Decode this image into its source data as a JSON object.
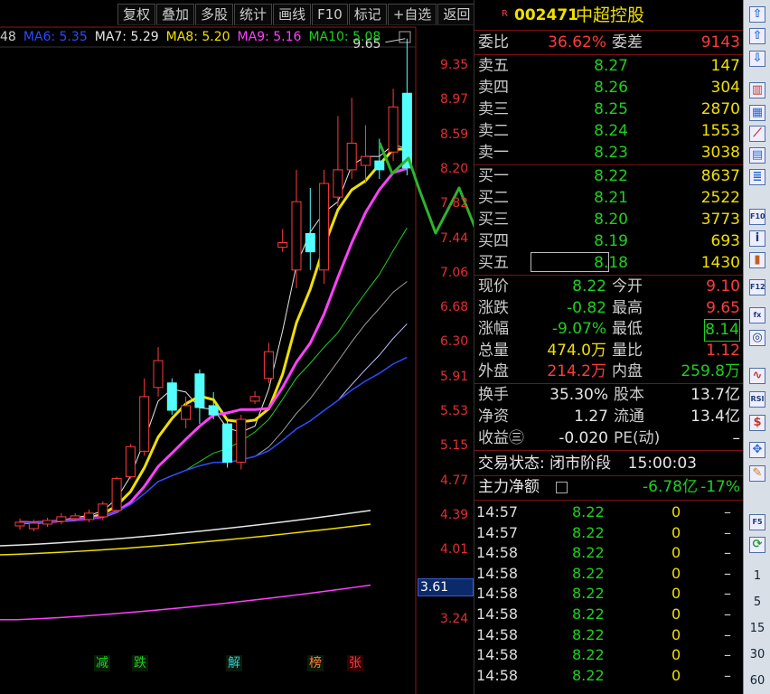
{
  "toolbar": [
    "复权",
    "叠加",
    "多股",
    "统计",
    "画线",
    "F10",
    "标记",
    "+自选",
    "返回"
  ],
  "ma_legend": [
    {
      "label": "48",
      "color": "#cccccc"
    },
    {
      "label": "MA6: 5.35",
      "color": "#2a4bff"
    },
    {
      "label": "MA7: 5.29",
      "color": "#e6e6e6"
    },
    {
      "label": "MA8: 5.20",
      "color": "#f0e000"
    },
    {
      "label": "MA9: 5.16",
      "color": "#ff40ff"
    },
    {
      "label": "MA10: 5.08",
      "color": "#1fd01f"
    }
  ],
  "chart_data": {
    "type": "candlestick",
    "price_ticks": [
      "9.35",
      "8.97",
      "8.59",
      "8.20",
      "7.82",
      "7.44",
      "7.06",
      "6.68",
      "6.30",
      "5.91",
      "5.53",
      "5.15",
      "4.77",
      "4.39",
      "4.01",
      "3.61",
      "3.24"
    ],
    "high_label": "9.65",
    "current_price_label": "3.61",
    "candles": [
      {
        "o": 4.28,
        "c": 4.32,
        "h": 4.36,
        "l": 4.24
      },
      {
        "o": 4.25,
        "c": 4.31,
        "h": 4.35,
        "l": 4.22
      },
      {
        "o": 4.3,
        "c": 4.34,
        "h": 4.37,
        "l": 4.27
      },
      {
        "o": 4.33,
        "c": 4.38,
        "h": 4.42,
        "l": 4.3
      },
      {
        "o": 4.36,
        "c": 4.39,
        "h": 4.42,
        "l": 4.33
      },
      {
        "o": 4.35,
        "c": 4.42,
        "h": 4.46,
        "l": 4.32
      },
      {
        "o": 4.38,
        "c": 4.52,
        "h": 4.55,
        "l": 4.34
      },
      {
        "o": 4.45,
        "c": 4.8,
        "h": 4.82,
        "l": 4.44
      },
      {
        "o": 4.82,
        "c": 5.15,
        "h": 5.18,
        "l": 4.8
      },
      {
        "o": 5.1,
        "c": 5.7,
        "h": 5.9,
        "l": 5.05
      },
      {
        "o": 5.8,
        "c": 6.1,
        "h": 6.25,
        "l": 5.7
      },
      {
        "o": 5.85,
        "c": 5.55,
        "h": 5.9,
        "l": 5.5
      },
      {
        "o": 5.45,
        "c": 5.6,
        "h": 5.7,
        "l": 5.35
      },
      {
        "o": 5.95,
        "c": 5.58,
        "h": 6.0,
        "l": 5.4
      },
      {
        "o": 5.6,
        "c": 5.5,
        "h": 5.75,
        "l": 5.45
      },
      {
        "o": 5.4,
        "c": 4.98,
        "h": 5.45,
        "l": 4.92
      },
      {
        "o": 4.98,
        "c": 5.45,
        "h": 5.5,
        "l": 4.9
      },
      {
        "o": 5.65,
        "c": 5.7,
        "h": 5.76,
        "l": 5.62
      },
      {
        "o": 5.9,
        "c": 6.2,
        "h": 6.3,
        "l": 5.85
      },
      {
        "o": 7.35,
        "c": 7.4,
        "h": 7.55,
        "l": 7.3
      },
      {
        "o": 7.1,
        "c": 7.85,
        "h": 8.2,
        "l": 6.9
      },
      {
        "o": 7.5,
        "c": 7.3,
        "h": 8.0,
        "l": 7.1
      },
      {
        "o": 7.1,
        "c": 8.05,
        "h": 8.2,
        "l": 6.95
      },
      {
        "o": 7.9,
        "c": 8.2,
        "h": 8.8,
        "l": 7.8
      },
      {
        "o": 8.2,
        "c": 8.5,
        "h": 9.0,
        "l": 8.1
      },
      {
        "o": 8.25,
        "c": 8.35,
        "h": 8.7,
        "l": 8.05
      },
      {
        "o": 8.3,
        "c": 8.2,
        "h": 8.55,
        "l": 8.1
      },
      {
        "o": 8.4,
        "c": 8.9,
        "h": 9.1,
        "l": 8.3
      },
      {
        "o": 9.05,
        "c": 8.22,
        "h": 9.65,
        "l": 8.14
      }
    ],
    "event_tags": [
      {
        "label": "减",
        "color": "#1fd01f"
      },
      {
        "label": "跌",
        "color": "#1fd01f"
      },
      {
        "label": "解",
        "color": "#33cccc"
      },
      {
        "label": "榜",
        "color": "#ff8030"
      },
      {
        "label": "张",
        "color": "#ff3b3b"
      }
    ]
  },
  "quote": {
    "code": "002471",
    "name": "中超控股",
    "weibi_label": "委比",
    "weibi_val": "36.62%",
    "weicha_label": "委差",
    "weicha_val": "9143",
    "asks": [
      {
        "label": "卖五",
        "price": "8.27",
        "vol": "147"
      },
      {
        "label": "卖四",
        "price": "8.26",
        "vol": "304"
      },
      {
        "label": "卖三",
        "price": "8.25",
        "vol": "2870"
      },
      {
        "label": "卖二",
        "price": "8.24",
        "vol": "1553"
      },
      {
        "label": "卖一",
        "price": "8.23",
        "vol": "3038"
      }
    ],
    "bids": [
      {
        "label": "买一",
        "price": "8.22",
        "vol": "8637"
      },
      {
        "label": "买二",
        "price": "8.21",
        "vol": "2522"
      },
      {
        "label": "买三",
        "price": "8.20",
        "vol": "3773"
      },
      {
        "label": "买四",
        "price": "8.19",
        "vol": "693"
      },
      {
        "label": "买五",
        "price": "8.18",
        "vol": "1430"
      }
    ],
    "stats": [
      {
        "l1": "现价",
        "v1": "8.22",
        "c1": "grn",
        "l2": "今开",
        "v2": "9.10",
        "c2": "red"
      },
      {
        "l1": "涨跌",
        "v1": "-0.82",
        "c1": "grn",
        "l2": "最高",
        "v2": "9.65",
        "c2": "red"
      },
      {
        "l1": "涨幅",
        "v1": "-9.07%",
        "c1": "grn",
        "l2": "最低",
        "v2": "8.14",
        "c2": "grn"
      },
      {
        "l1": "总量",
        "v1": "474.0万",
        "c1": "yel",
        "l2": "量比",
        "v2": "1.12",
        "c2": "red"
      },
      {
        "l1": "外盘",
        "v1": "214.2万",
        "c1": "red",
        "l2": "内盘",
        "v2": "259.8万",
        "c2": "grn"
      }
    ],
    "fundamentals": [
      {
        "l1": "换手",
        "v1": "35.30%",
        "l2": "股本",
        "v2": "13.7亿"
      },
      {
        "l1": "净资",
        "v1": "1.27",
        "l2": "流通",
        "v2": "13.4亿"
      },
      {
        "l1": "收益㊂",
        "v1": "-0.020",
        "l2": "PE(动)",
        "v2": "–"
      }
    ],
    "trade_status_label": "交易状态: 闭市阶段",
    "trade_status_time": "15:00:03",
    "main_flow_label": "主力净额",
    "main_flow_val": "-6.78亿",
    "main_flow_pct": "-17%",
    "ticks": [
      {
        "t": "14:57",
        "p": "8.22",
        "q": "0",
        "d": "–"
      },
      {
        "t": "14:57",
        "p": "8.22",
        "q": "0",
        "d": "–"
      },
      {
        "t": "14:58",
        "p": "8.22",
        "q": "0",
        "d": "–"
      },
      {
        "t": "14:58",
        "p": "8.22",
        "q": "0",
        "d": "–"
      },
      {
        "t": "14:58",
        "p": "8.22",
        "q": "0",
        "d": "–"
      },
      {
        "t": "14:58",
        "p": "8.22",
        "q": "0",
        "d": "–"
      },
      {
        "t": "14:58",
        "p": "8.22",
        "q": "0",
        "d": "–"
      },
      {
        "t": "14:58",
        "p": "8.22",
        "q": "0",
        "d": "–"
      },
      {
        "t": "14:58",
        "p": "8.22",
        "q": "0",
        "d": "–"
      }
    ]
  },
  "right_icons": [
    "up-arrow-icon",
    "up-outline-arrow-icon",
    "down-outline-arrow-icon",
    "candlestick-icon",
    "grid-icon",
    "line-chart-icon",
    "bar-chart-icon",
    "list-icon",
    "f10-icon",
    "info-icon",
    "notebook-icon",
    "f12-icon",
    "fx-icon",
    "circle-icon",
    "wave-icon",
    "rsi-icon",
    "dollar-icon",
    "move-icon",
    "pencil-icon",
    "f5-icon",
    "refresh-icon"
  ],
  "right_numbers": [
    "1",
    "5",
    "15",
    "30",
    "60"
  ]
}
